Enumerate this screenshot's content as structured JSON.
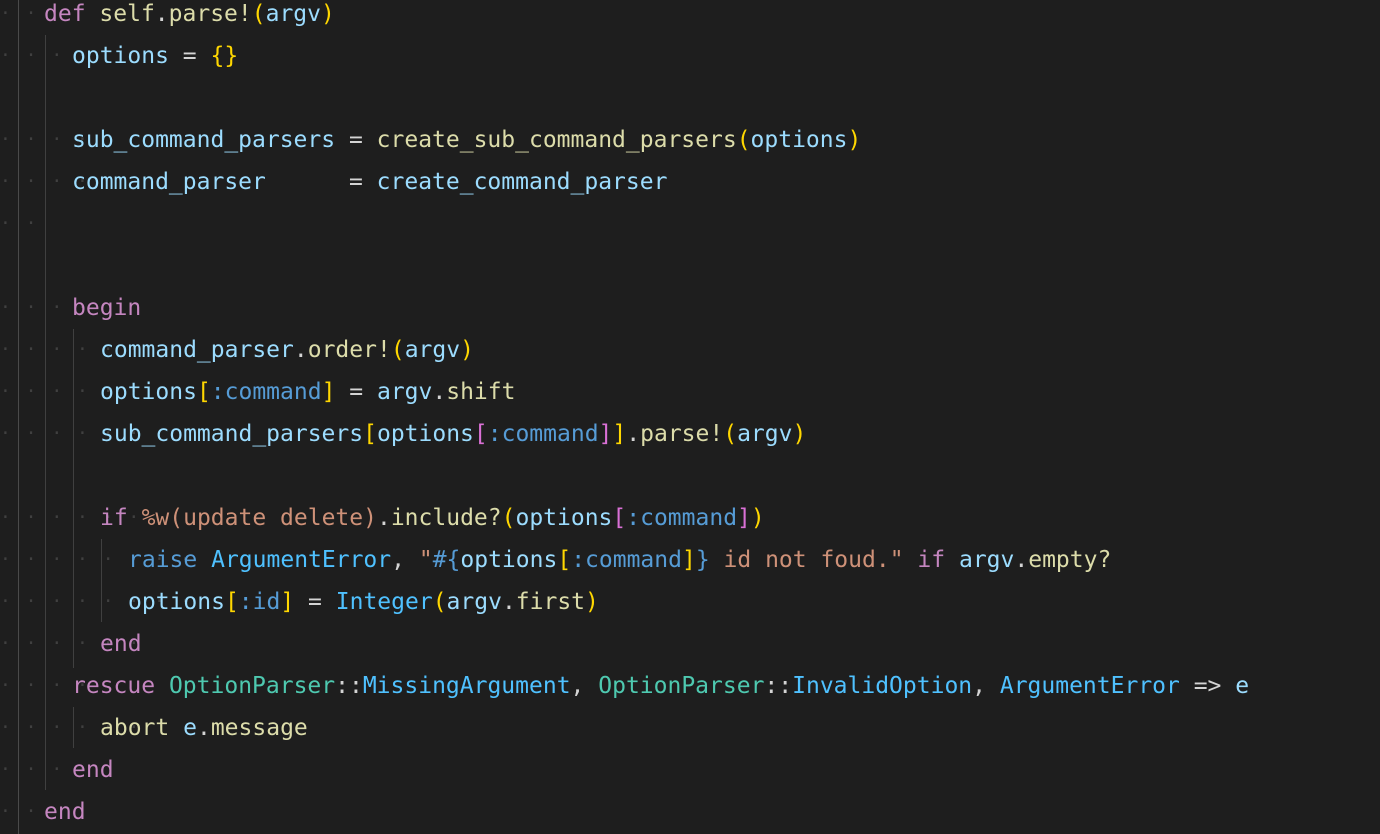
{
  "editor": {
    "language": "ruby",
    "lines": [
      {
        "indent": 1,
        "tokens": [
          {
            "t": "def",
            "c": "kw"
          },
          {
            "t": " ",
            "c": "plain"
          },
          {
            "t": "self",
            "c": "fn"
          },
          {
            "t": ".",
            "c": "plain"
          },
          {
            "t": "parse!",
            "c": "fn"
          },
          {
            "t": "(",
            "c": "br1"
          },
          {
            "t": "argv",
            "c": "var"
          },
          {
            "t": ")",
            "c": "br1"
          }
        ]
      },
      {
        "indent": 2,
        "tokens": [
          {
            "t": "options",
            "c": "var"
          },
          {
            "t": " = ",
            "c": "op"
          },
          {
            "t": "{}",
            "c": "br1"
          }
        ]
      },
      {
        "indent": 0,
        "tokens": []
      },
      {
        "indent": 2,
        "tokens": [
          {
            "t": "sub_command_parsers",
            "c": "var"
          },
          {
            "t": " = ",
            "c": "op"
          },
          {
            "t": "create_sub_command_parsers",
            "c": "fn"
          },
          {
            "t": "(",
            "c": "br1"
          },
          {
            "t": "options",
            "c": "var"
          },
          {
            "t": ")",
            "c": "br1"
          }
        ]
      },
      {
        "indent": 2,
        "tokens": [
          {
            "t": "command_parser",
            "c": "var"
          },
          {
            "t": "      = ",
            "c": "op"
          },
          {
            "t": "create_command_parser",
            "c": "var"
          }
        ]
      },
      {
        "indent": 1,
        "tokens": []
      },
      {
        "indent": 0,
        "tokens": []
      },
      {
        "indent": 2,
        "tokens": [
          {
            "t": "begin",
            "c": "kw"
          }
        ]
      },
      {
        "indent": 3,
        "tokens": [
          {
            "t": "command_parser",
            "c": "var"
          },
          {
            "t": ".",
            "c": "plain"
          },
          {
            "t": "order!",
            "c": "fn"
          },
          {
            "t": "(",
            "c": "br1"
          },
          {
            "t": "argv",
            "c": "var"
          },
          {
            "t": ")",
            "c": "br1"
          }
        ]
      },
      {
        "indent": 3,
        "tokens": [
          {
            "t": "options",
            "c": "var"
          },
          {
            "t": "[",
            "c": "br1"
          },
          {
            "t": ":command",
            "c": "sym"
          },
          {
            "t": "]",
            "c": "br1"
          },
          {
            "t": " = ",
            "c": "op"
          },
          {
            "t": "argv",
            "c": "var"
          },
          {
            "t": ".",
            "c": "plain"
          },
          {
            "t": "shift",
            "c": "fn"
          }
        ]
      },
      {
        "indent": 3,
        "tokens": [
          {
            "t": "sub_command_parsers",
            "c": "var"
          },
          {
            "t": "[",
            "c": "br1"
          },
          {
            "t": "options",
            "c": "var"
          },
          {
            "t": "[",
            "c": "br2"
          },
          {
            "t": ":command",
            "c": "sym"
          },
          {
            "t": "]",
            "c": "br2"
          },
          {
            "t": "]",
            "c": "br1"
          },
          {
            "t": ".",
            "c": "plain"
          },
          {
            "t": "parse!",
            "c": "fn"
          },
          {
            "t": "(",
            "c": "br1"
          },
          {
            "t": "argv",
            "c": "var"
          },
          {
            "t": ")",
            "c": "br1"
          }
        ]
      },
      {
        "indent": 0,
        "tokens": []
      },
      {
        "indent": 3,
        "tokens": [
          {
            "t": "if",
            "c": "kw"
          },
          {
            "t": " ",
            "c": "plain"
          },
          {
            "t": "%w(update delete)",
            "c": "str"
          },
          {
            "t": ".",
            "c": "plain"
          },
          {
            "t": "include?",
            "c": "fn"
          },
          {
            "t": "(",
            "c": "br1"
          },
          {
            "t": "options",
            "c": "var"
          },
          {
            "t": "[",
            "c": "br2"
          },
          {
            "t": ":command",
            "c": "sym"
          },
          {
            "t": "]",
            "c": "br2"
          },
          {
            "t": ")",
            "c": "br1"
          }
        ]
      },
      {
        "indent": 4,
        "tokens": [
          {
            "t": "raise",
            "c": "sym"
          },
          {
            "t": " ",
            "c": "plain"
          },
          {
            "t": "ArgumentError",
            "c": "cls2"
          },
          {
            "t": ", ",
            "c": "plain"
          },
          {
            "t": "\"",
            "c": "str"
          },
          {
            "t": "#{",
            "c": "interp"
          },
          {
            "t": "options",
            "c": "var"
          },
          {
            "t": "[",
            "c": "br1"
          },
          {
            "t": ":command",
            "c": "sym"
          },
          {
            "t": "]",
            "c": "br1"
          },
          {
            "t": "}",
            "c": "interp"
          },
          {
            "t": " id not foud.\"",
            "c": "str"
          },
          {
            "t": " ",
            "c": "plain"
          },
          {
            "t": "if",
            "c": "kw"
          },
          {
            "t": " ",
            "c": "plain"
          },
          {
            "t": "argv",
            "c": "var"
          },
          {
            "t": ".",
            "c": "plain"
          },
          {
            "t": "empty?",
            "c": "fn"
          }
        ]
      },
      {
        "indent": 4,
        "tokens": [
          {
            "t": "options",
            "c": "var"
          },
          {
            "t": "[",
            "c": "br1"
          },
          {
            "t": ":id",
            "c": "sym"
          },
          {
            "t": "]",
            "c": "br1"
          },
          {
            "t": " = ",
            "c": "op"
          },
          {
            "t": "Integer",
            "c": "cls2"
          },
          {
            "t": "(",
            "c": "br1"
          },
          {
            "t": "argv",
            "c": "var"
          },
          {
            "t": ".",
            "c": "plain"
          },
          {
            "t": "first",
            "c": "fn"
          },
          {
            "t": ")",
            "c": "br1"
          }
        ]
      },
      {
        "indent": 3,
        "tokens": [
          {
            "t": "end",
            "c": "kw"
          }
        ]
      },
      {
        "indent": 2,
        "tokens": [
          {
            "t": "rescue",
            "c": "kw"
          },
          {
            "t": " ",
            "c": "plain"
          },
          {
            "t": "OptionParser",
            "c": "cls"
          },
          {
            "t": "::",
            "c": "plain"
          },
          {
            "t": "MissingArgument",
            "c": "cls2"
          },
          {
            "t": ", ",
            "c": "plain"
          },
          {
            "t": "OptionParser",
            "c": "cls"
          },
          {
            "t": "::",
            "c": "plain"
          },
          {
            "t": "InvalidOption",
            "c": "cls2"
          },
          {
            "t": ", ",
            "c": "plain"
          },
          {
            "t": "ArgumentError",
            "c": "cls2"
          },
          {
            "t": " => ",
            "c": "op"
          },
          {
            "t": "e",
            "c": "var"
          }
        ]
      },
      {
        "indent": 3,
        "tokens": [
          {
            "t": "abort",
            "c": "fn"
          },
          {
            "t": " ",
            "c": "plain"
          },
          {
            "t": "e",
            "c": "var"
          },
          {
            "t": ".",
            "c": "plain"
          },
          {
            "t": "message",
            "c": "fn"
          }
        ]
      },
      {
        "indent": 2,
        "tokens": [
          {
            "t": "end",
            "c": "kw"
          }
        ]
      },
      {
        "indent": 1,
        "tokens": [
          {
            "t": "end",
            "c": "kw"
          }
        ]
      }
    ]
  }
}
